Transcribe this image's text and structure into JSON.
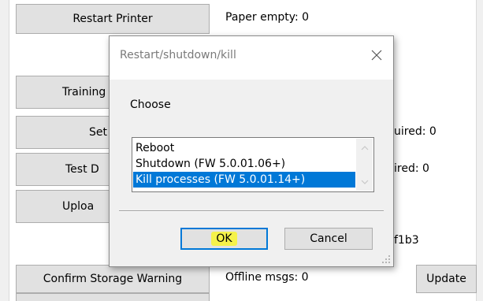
{
  "background": {
    "restart_printer_label": "Restart Printer",
    "paper_empty_label": "Paper empty: 0",
    "training_label": "Training",
    "set_label": "Set",
    "test_label": "Test D",
    "upload_label": "Uploa",
    "required_1": "uired: 0",
    "required_2": "ired: 0",
    "hash_fragment": "f1b3",
    "confirm_storage_label": "Confirm Storage Warning",
    "offline_msgs_label": "Offline msgs: 0",
    "update_label": "Update"
  },
  "dialog": {
    "title": "Restart/shutdown/kill",
    "choose_label": "Choose",
    "options": [
      "Reboot",
      "Shutdown (FW 5.0.01.06+)",
      "Kill processes (FW 5.0.01.14+)"
    ],
    "selected_index": 2,
    "ok_label": "OK",
    "cancel_label": "Cancel"
  },
  "colors": {
    "selection": "#0078d7",
    "highlight": "#f5f24a",
    "button_face": "#e1e1e1"
  },
  "icons": {
    "close": "close-icon",
    "scroll_up": "chevron-up-icon",
    "scroll_down": "chevron-down-icon",
    "grip": "resize-grip-icon"
  }
}
